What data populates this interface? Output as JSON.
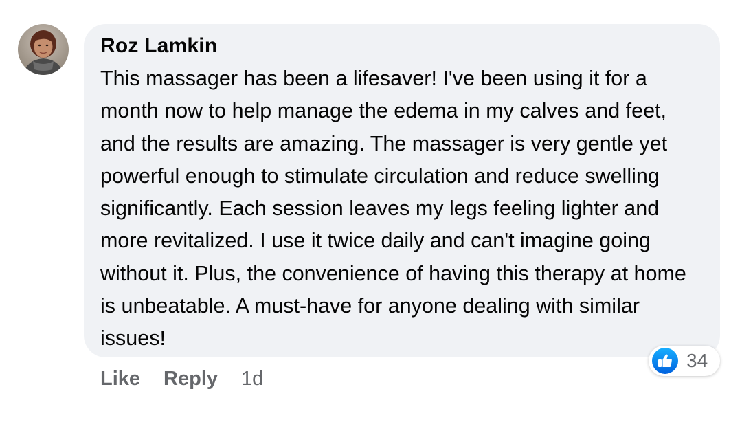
{
  "comment": {
    "author": "Roz Lamkin",
    "text": "This massager has been a lifesaver! I've been using it for a month now to help manage the edema in my calves and feet, and the results are amazing. The massager is very gentle yet powerful enough to stimulate circulation and reduce swelling significantly. Each session leaves my legs feeling lighter and more revitalized. I use it twice daily and can't imagine going without it. Plus, the convenience of having this therapy at home is unbeatable. A must-have for anyone dealing with similar issues!",
    "avatar_icon": "person-avatar-photo",
    "reactions": {
      "icon": "thumbs-up-icon",
      "count": "34",
      "color": "#1877f2"
    },
    "actions": {
      "like_label": "Like",
      "reply_label": "Reply",
      "timestamp": "1d"
    }
  },
  "colors": {
    "bubble_background": "#f0f2f5",
    "text": "#050505",
    "secondary_text": "#65676b",
    "like_blue": "#1877f2"
  }
}
